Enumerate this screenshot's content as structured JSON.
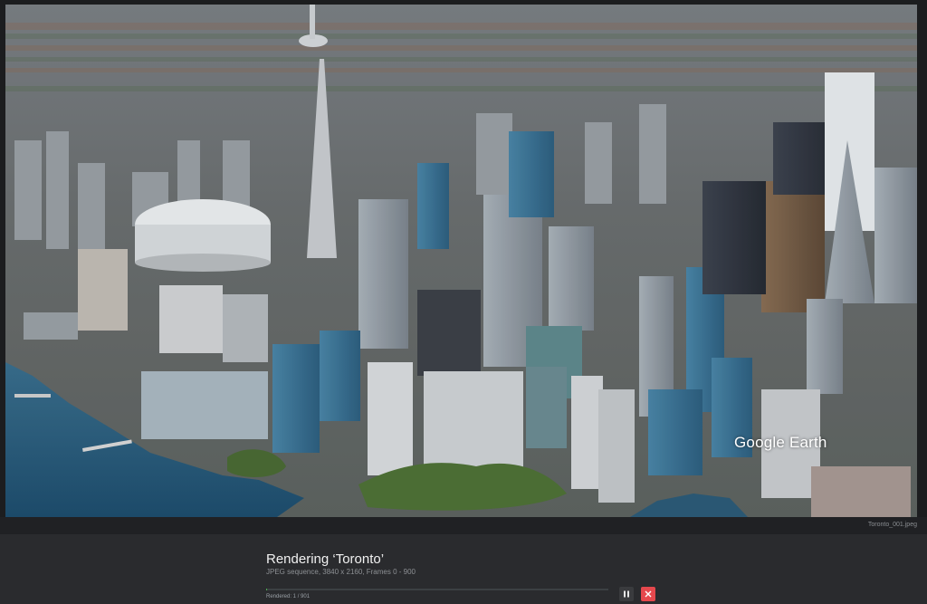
{
  "preview": {
    "watermark": "Google Earth",
    "filename": "Toronto_001.jpeg"
  },
  "render": {
    "title": "Rendering ‘Toronto’",
    "subtitle": "JPEG sequence, 3840 x 2160, Frames 0 - 900",
    "status": "Rendered: 1 / 901",
    "progress_fraction": 0.00111
  },
  "controls": {
    "pause_icon": "pause-icon",
    "cancel_icon": "close-icon"
  },
  "colors": {
    "progress": "#4caf50",
    "cancel": "#e5484d",
    "panel": "#2a2b2e"
  }
}
